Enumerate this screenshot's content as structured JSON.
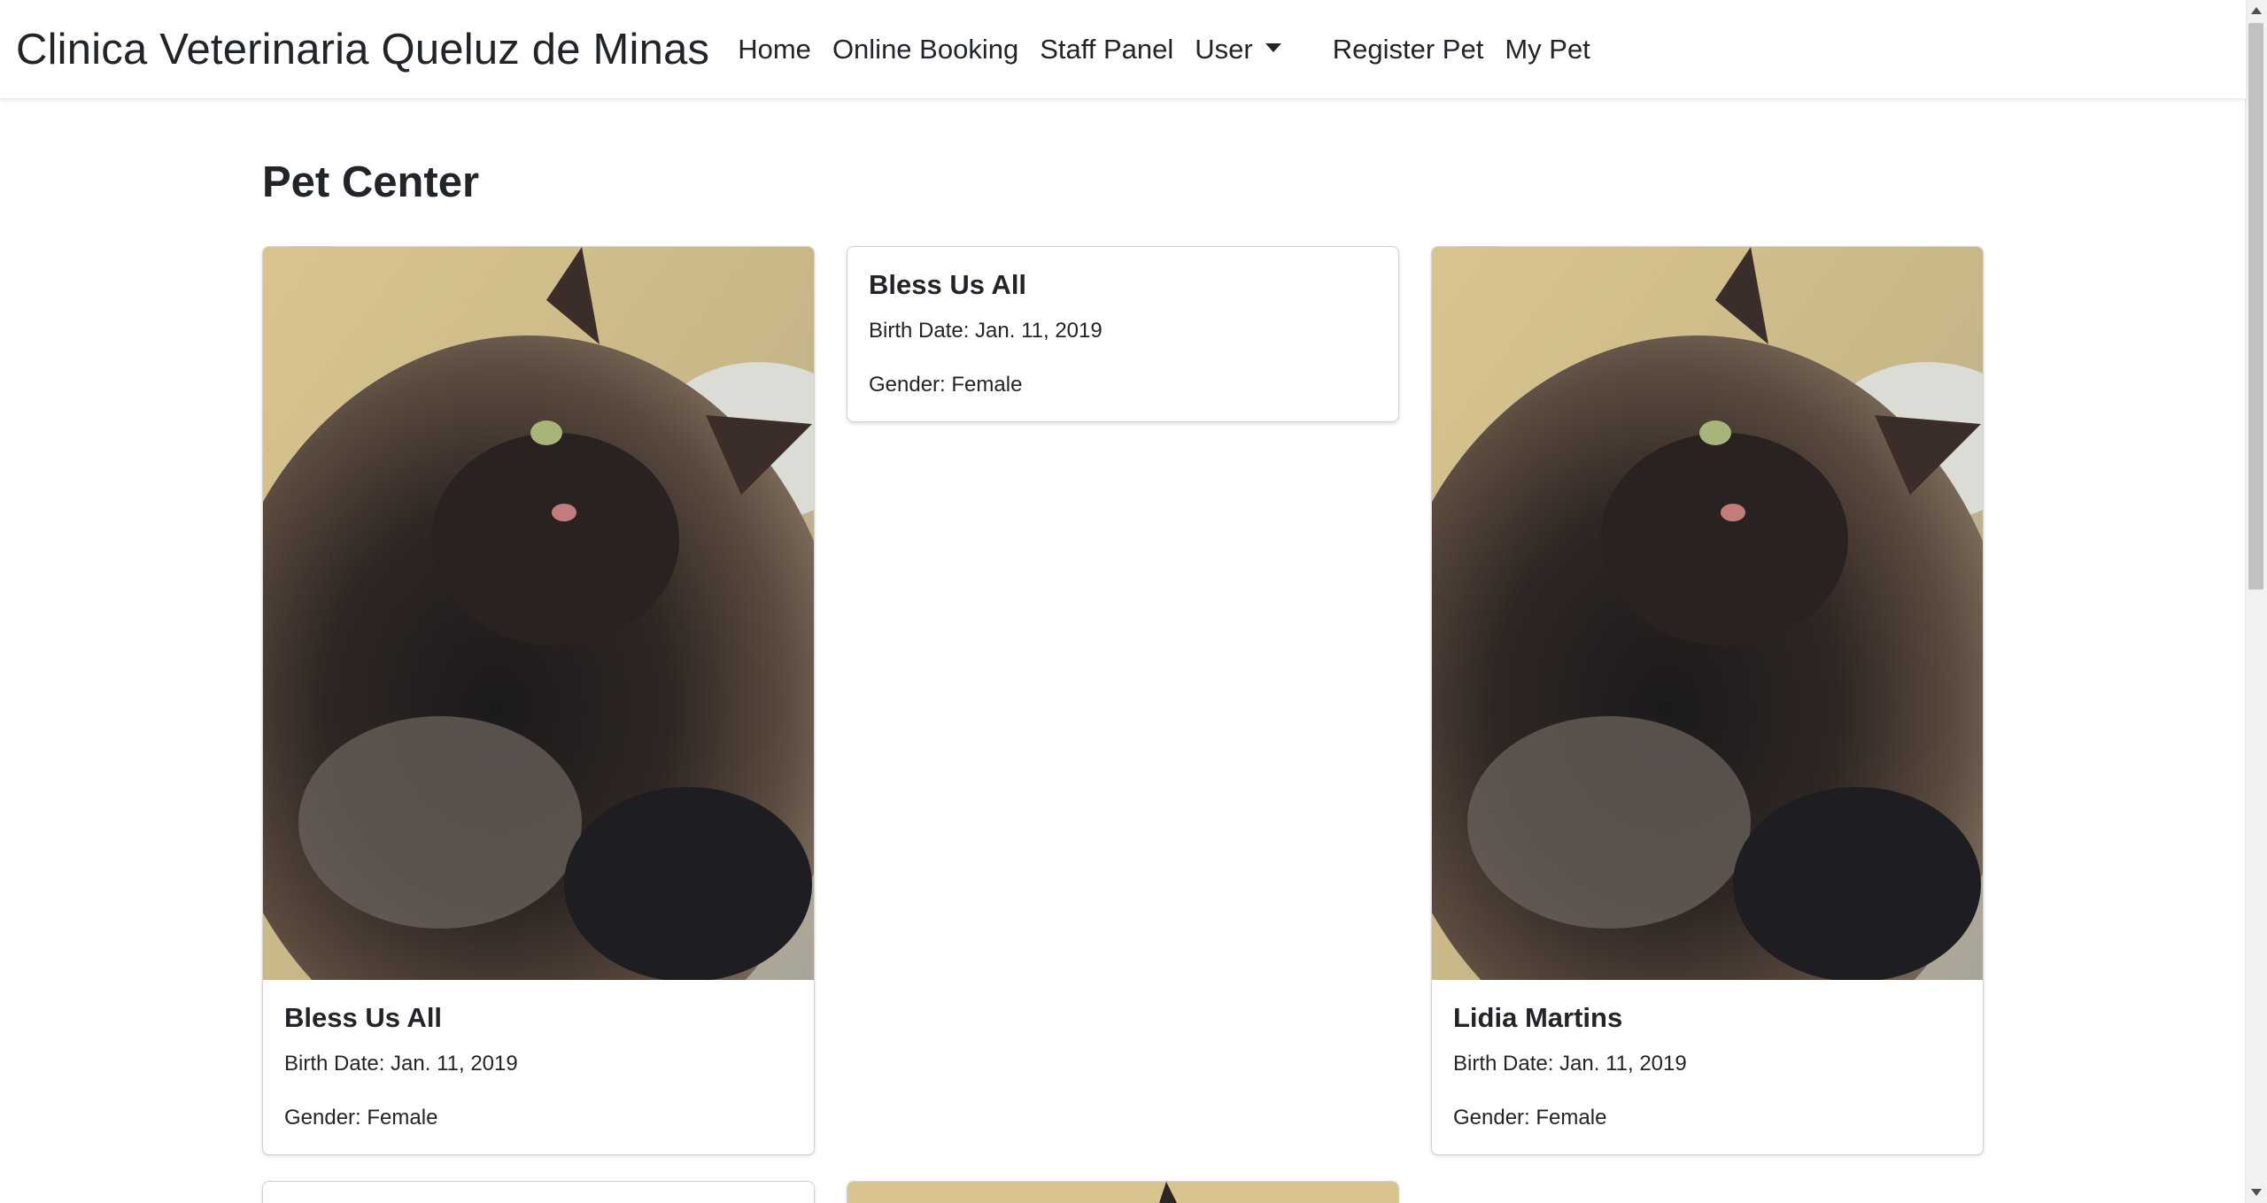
{
  "navbar": {
    "brand": "Clinica Veterinaria Queluz de Minas",
    "links": {
      "home": "Home",
      "online_booking": "Online Booking",
      "staff_panel": "Staff Panel",
      "user": "User",
      "register_pet": "Register Pet",
      "my_pet": "My Pet"
    }
  },
  "page": {
    "title": "Pet Center"
  },
  "pets": [
    {
      "name": "Bless Us All",
      "birth_date": "Birth Date: Jan. 11, 2019",
      "gender": "Gender: Female",
      "has_photo": true
    },
    {
      "name": "Bless Us All",
      "birth_date": "Birth Date: Jan. 11, 2019",
      "gender": "Gender: Female",
      "has_photo": false
    },
    {
      "name": "Lidia Martins",
      "birth_date": "Birth Date: Jan. 11, 2019",
      "gender": "Gender: Female",
      "has_photo": true
    }
  ],
  "icons": {
    "dropdown": "chevron-down-icon"
  },
  "colors": {
    "text": "#212529",
    "background": "#ffffff",
    "card_border": "#d9d9d9"
  }
}
